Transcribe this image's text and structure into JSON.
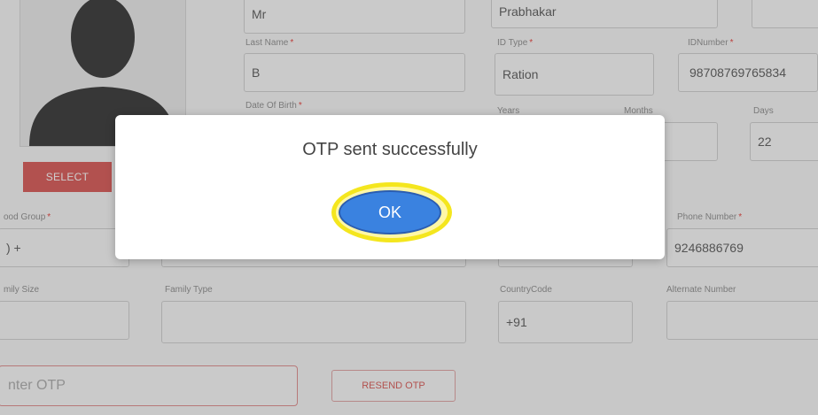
{
  "form": {
    "title_value": "Mr",
    "first_name_value": "Prabhakar",
    "last_name_label": "Last Name",
    "last_name_value": "B",
    "id_type_label": "ID Type",
    "id_type_value": "Ration",
    "id_number_label": "IDNumber",
    "id_number_value": "98708769765834",
    "dob_label": "Date Of Birth",
    "years_label": "Years",
    "months_label": "Months",
    "days_label": "Days",
    "days_value": "22",
    "blood_group_label": "ood Group",
    "blood_group_value": ") +",
    "phone_label": "Phone Number",
    "phone_value": "9246886769",
    "family_size_label": "mily Size",
    "family_type_label": "Family Type",
    "country_code_label": "CountryCode",
    "country_code_value": "+91",
    "alternate_number_label": "Alternate Number",
    "required_marker": "*"
  },
  "photo": {
    "select_label": "SELECT"
  },
  "otp": {
    "placeholder": "nter OTP",
    "resend_label": "RESEND OTP"
  },
  "modal": {
    "message": "OTP sent successfully",
    "ok_label": "OK"
  },
  "colors": {
    "accent_red": "#d9534f",
    "ok_blue": "#3a82e0",
    "highlight_yellow": "#f4e61e"
  }
}
